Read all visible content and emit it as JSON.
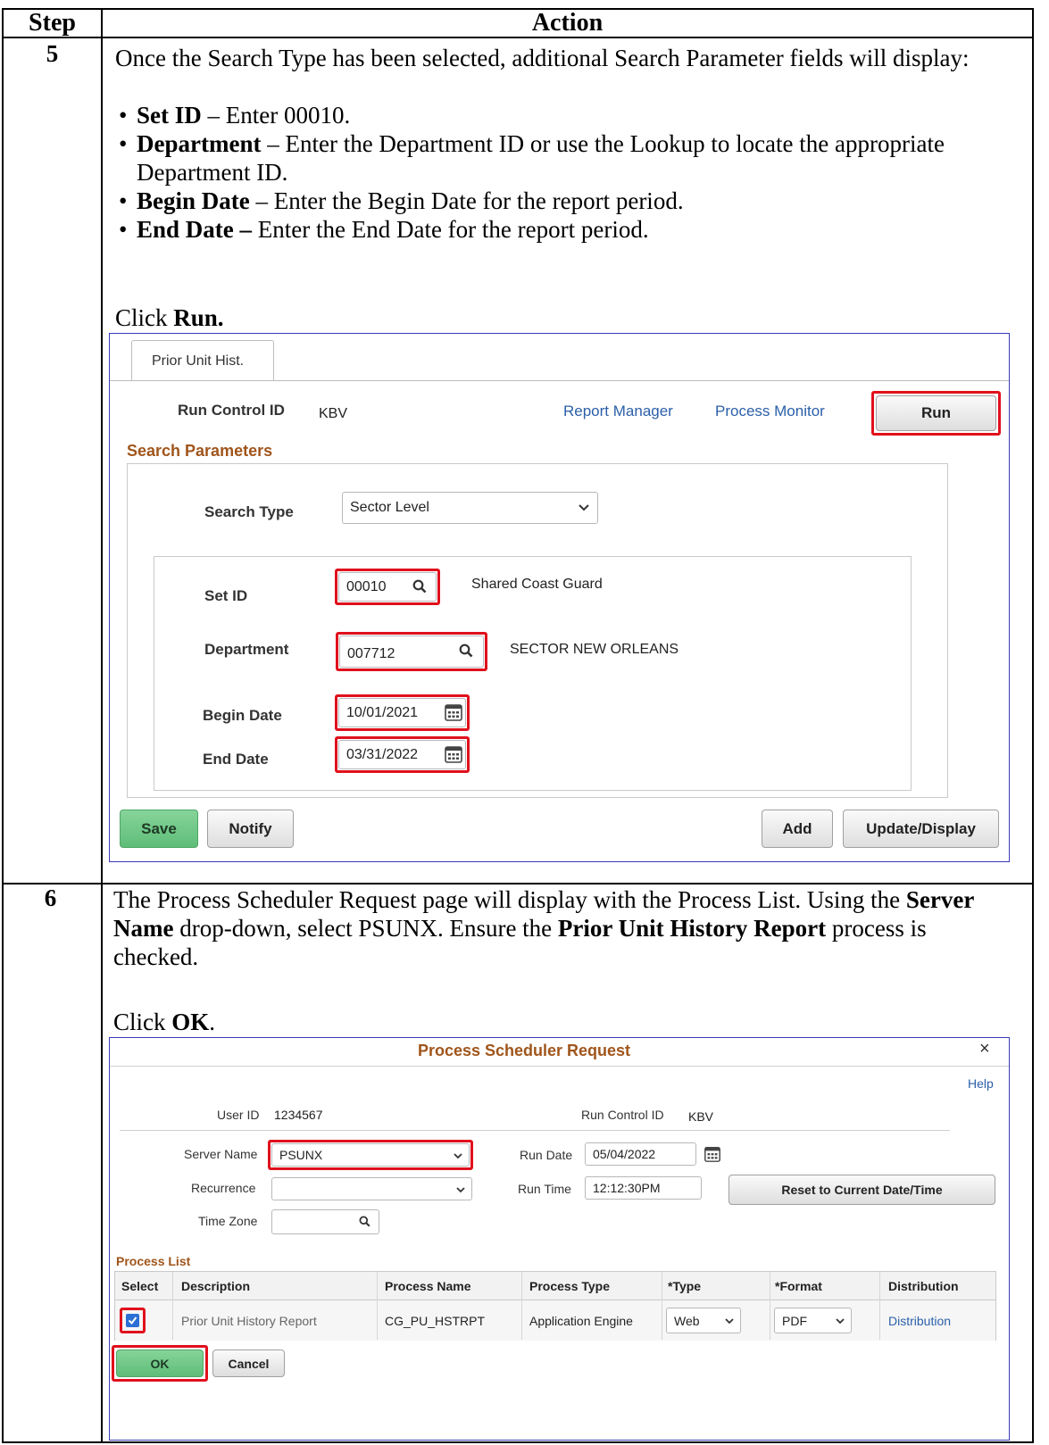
{
  "table": {
    "header_step": "Step",
    "header_action": "Action"
  },
  "step5": {
    "num": "5",
    "intro": "Once the Search Type has been selected, additional Search Parameter fields will display:",
    "bullets": [
      {
        "term": "Set ID",
        "sep": " – ",
        "text": "Enter 00010."
      },
      {
        "term": "Department",
        "sep": " – ",
        "text": "Enter the Department ID or use the Lookup to locate the appropriate Department ID."
      },
      {
        "term": "Begin Date",
        "sep": " – ",
        "text": "Enter the Begin Date for the report period."
      },
      {
        "term": "End Date –",
        "sep": " ",
        "text": "Enter the End Date for the report period."
      }
    ],
    "click_prefix": "Click ",
    "click_bold": "Run."
  },
  "screen1": {
    "tab_label": "Prior Unit Hist.",
    "run_control_label": "Run Control ID",
    "run_control_value": "KBV",
    "report_manager": "Report Manager",
    "process_monitor": "Process Monitor",
    "run_button": "Run",
    "section_title": "Search Parameters",
    "search_type_label": "Search Type",
    "search_type_value": "Sector Level",
    "setid_label": "Set ID",
    "setid_value": "00010",
    "setid_desc": "Shared Coast Guard",
    "dept_label": "Department",
    "dept_value": "007712",
    "dept_desc": "SECTOR NEW ORLEANS",
    "begin_label": "Begin Date",
    "begin_value": "10/01/2021",
    "end_label": "End Date",
    "end_value": "03/31/2022",
    "save_button": "Save",
    "notify_button": "Notify",
    "add_button": "Add",
    "update_button": "Update/Display",
    "accent_color": "#e0101c",
    "link_color": "#2b5fa8",
    "section_color": "#a0551b"
  },
  "step6": {
    "num": "6",
    "p1_a": "The Process Scheduler Request page will display with the Process List.  Using the ",
    "p1_b": "Server Name",
    "p1_c": " drop-down, select PSUNX.  Ensure the ",
    "p1_d": "Prior Unit History Report",
    "p1_e": " process is checked.",
    "click_prefix": "Click ",
    "click_bold": "OK",
    "click_suffix": "."
  },
  "screen2": {
    "title": "Process Scheduler Request",
    "close": "×",
    "help": "Help",
    "userid_label": "User ID",
    "userid_value": "1234567",
    "rc_label": "Run Control ID",
    "rc_value": "KBV",
    "server_label": "Server Name",
    "server_value": "PSUNX",
    "rundate_label": "Run Date",
    "rundate_value": "05/04/2022",
    "recurrence_label": "Recurrence",
    "recurrence_value": "",
    "runtime_label": "Run Time",
    "runtime_value": "12:12:30PM",
    "reset_button": "Reset to Current Date/Time",
    "tz_label": "Time Zone",
    "tz_value": "",
    "process_list_title": "Process List",
    "columns": [
      "Select",
      "Description",
      "Process Name",
      "Process Type",
      "*Type",
      "*Format",
      "Distribution"
    ],
    "row": {
      "description": "Prior Unit History Report",
      "process_name": "CG_PU_HSTRPT",
      "process_type": "Application Engine",
      "type": "Web",
      "format": "PDF",
      "distribution": "Distribution"
    },
    "ok_button": "OK",
    "cancel_button": "Cancel"
  }
}
